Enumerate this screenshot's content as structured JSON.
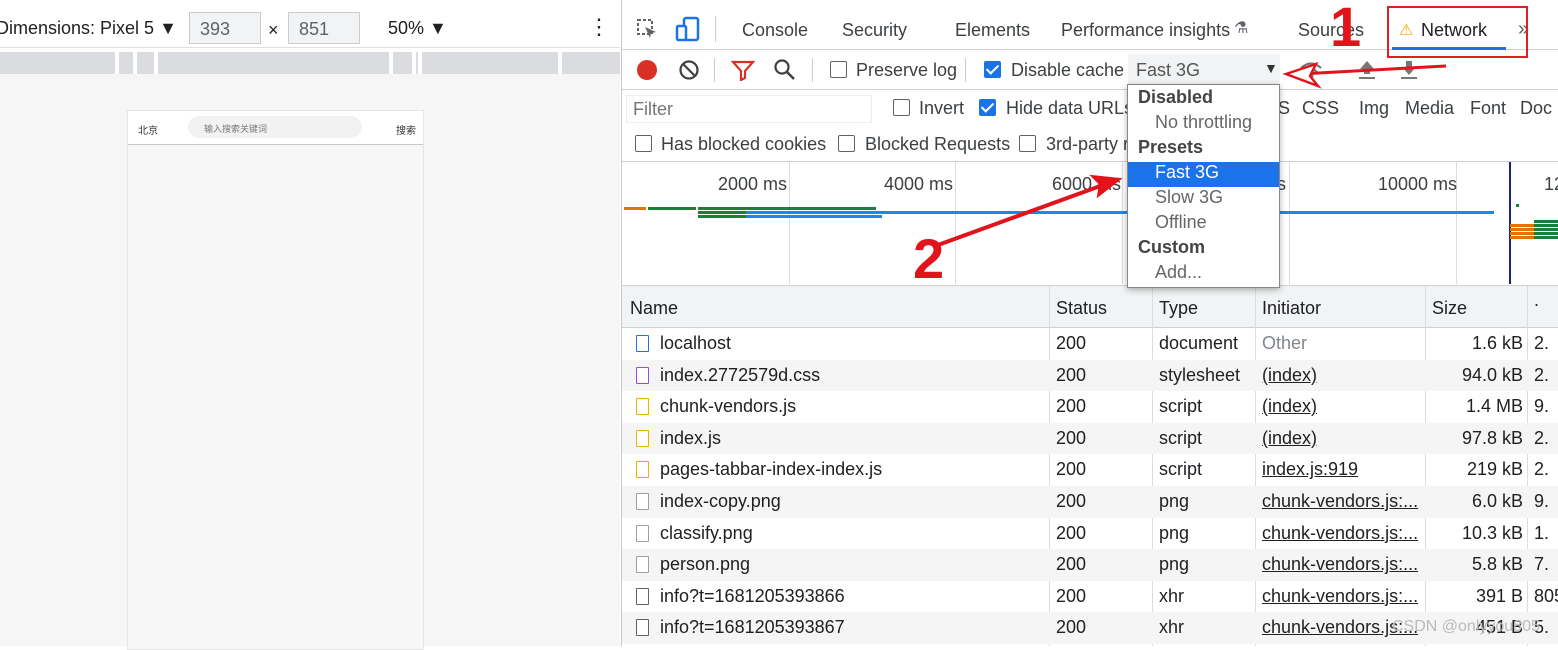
{
  "emulation": {
    "dimensions_label": "Dimensions: Pixel 5 ▼",
    "width": "393",
    "height": "851",
    "times": "×",
    "zoom": "50% ▼",
    "more": "⋮"
  },
  "phone": {
    "city": "北京",
    "search_placeholder": "输入搜索关键词",
    "search_button": "搜索"
  },
  "devtools": {
    "tabs": [
      "Console",
      "Security",
      "Elements",
      "Performance insights",
      "Sources",
      "Network"
    ],
    "active_tab": "Network",
    "more_tabs": "»",
    "toolbar": {
      "preserve_log": "Preserve log",
      "preserve_log_checked": false,
      "disable_cache": "Disable cache",
      "disable_cache_checked": true,
      "throttling": "Fast 3G"
    },
    "filter": {
      "placeholder": "Filter",
      "invert": "Invert",
      "hide_data_urls": "Hide data URLs",
      "types": [
        "JS",
        "CSS",
        "Img",
        "Media",
        "Font",
        "Doc"
      ],
      "has_blocked_cookies": "Has blocked cookies",
      "blocked_requests": "Blocked Requests",
      "third_party": "3rd-party r"
    },
    "timeline_ticks": [
      "2000 ms",
      "4000 ms",
      "6000 ms",
      "s",
      "10000 ms",
      "12"
    ],
    "throttling_menu": {
      "groups": [
        {
          "header": "Disabled",
          "options": [
            "No throttling"
          ]
        },
        {
          "header": "Presets",
          "options": [
            "Fast 3G",
            "Slow 3G",
            "Offline"
          ]
        },
        {
          "header": "Custom",
          "options": [
            "Add..."
          ]
        }
      ],
      "selected": "Fast 3G"
    },
    "table": {
      "columns": [
        "Name",
        "Status",
        "Type",
        "Initiator",
        "Size",
        "."
      ],
      "rows": [
        {
          "name": "localhost",
          "status": "200",
          "type": "document",
          "initiator": "Other",
          "size": "1.6 kB",
          "time": "2.",
          "icon": "document-icon"
        },
        {
          "name": "index.2772579d.css",
          "status": "200",
          "type": "stylesheet",
          "initiator": "(index)",
          "size": "94.0 kB",
          "time": "2.",
          "icon": "stylesheet-icon"
        },
        {
          "name": "chunk-vendors.js",
          "status": "200",
          "type": "script",
          "initiator": "(index)",
          "size": "1.4 MB",
          "time": "9.",
          "icon": "script-icon"
        },
        {
          "name": "index.js",
          "status": "200",
          "type": "script",
          "initiator": "(index)",
          "size": "97.8 kB",
          "time": "2.",
          "icon": "script-icon"
        },
        {
          "name": "pages-tabbar-index-index.js",
          "status": "200",
          "type": "script",
          "initiator": "index.js:919",
          "size": "219 kB",
          "time": "2.",
          "icon": "script-icon"
        },
        {
          "name": "index-copy.png",
          "status": "200",
          "type": "png",
          "initiator": "chunk-vendors.js:...",
          "size": "6.0 kB",
          "time": "9.",
          "icon": "image-icon"
        },
        {
          "name": "classify.png",
          "status": "200",
          "type": "png",
          "initiator": "chunk-vendors.js:...",
          "size": "10.3 kB",
          "time": "1.",
          "icon": "image-icon"
        },
        {
          "name": "person.png",
          "status": "200",
          "type": "png",
          "initiator": "chunk-vendors.js:...",
          "size": "5.8 kB",
          "time": "7.",
          "icon": "image-icon"
        },
        {
          "name": "info?t=1681205393866",
          "status": "200",
          "type": "xhr",
          "initiator": "chunk-vendors.js:...",
          "size": "391 B",
          "time": "805.",
          "icon": "xhr-icon"
        },
        {
          "name": "info?t=1681205393867",
          "status": "200",
          "type": "xhr",
          "initiator": "chunk-vendors.js:...",
          "size": "451 B",
          "time": "5.",
          "icon": "xhr-icon"
        }
      ]
    }
  },
  "annotations": {
    "step1": "1",
    "step2": "2"
  },
  "watermark": "CSDN @onlyyou805",
  "colors": {
    "accent": "#1a73e8",
    "annotation": "#e3131b",
    "record": "#d93025"
  }
}
